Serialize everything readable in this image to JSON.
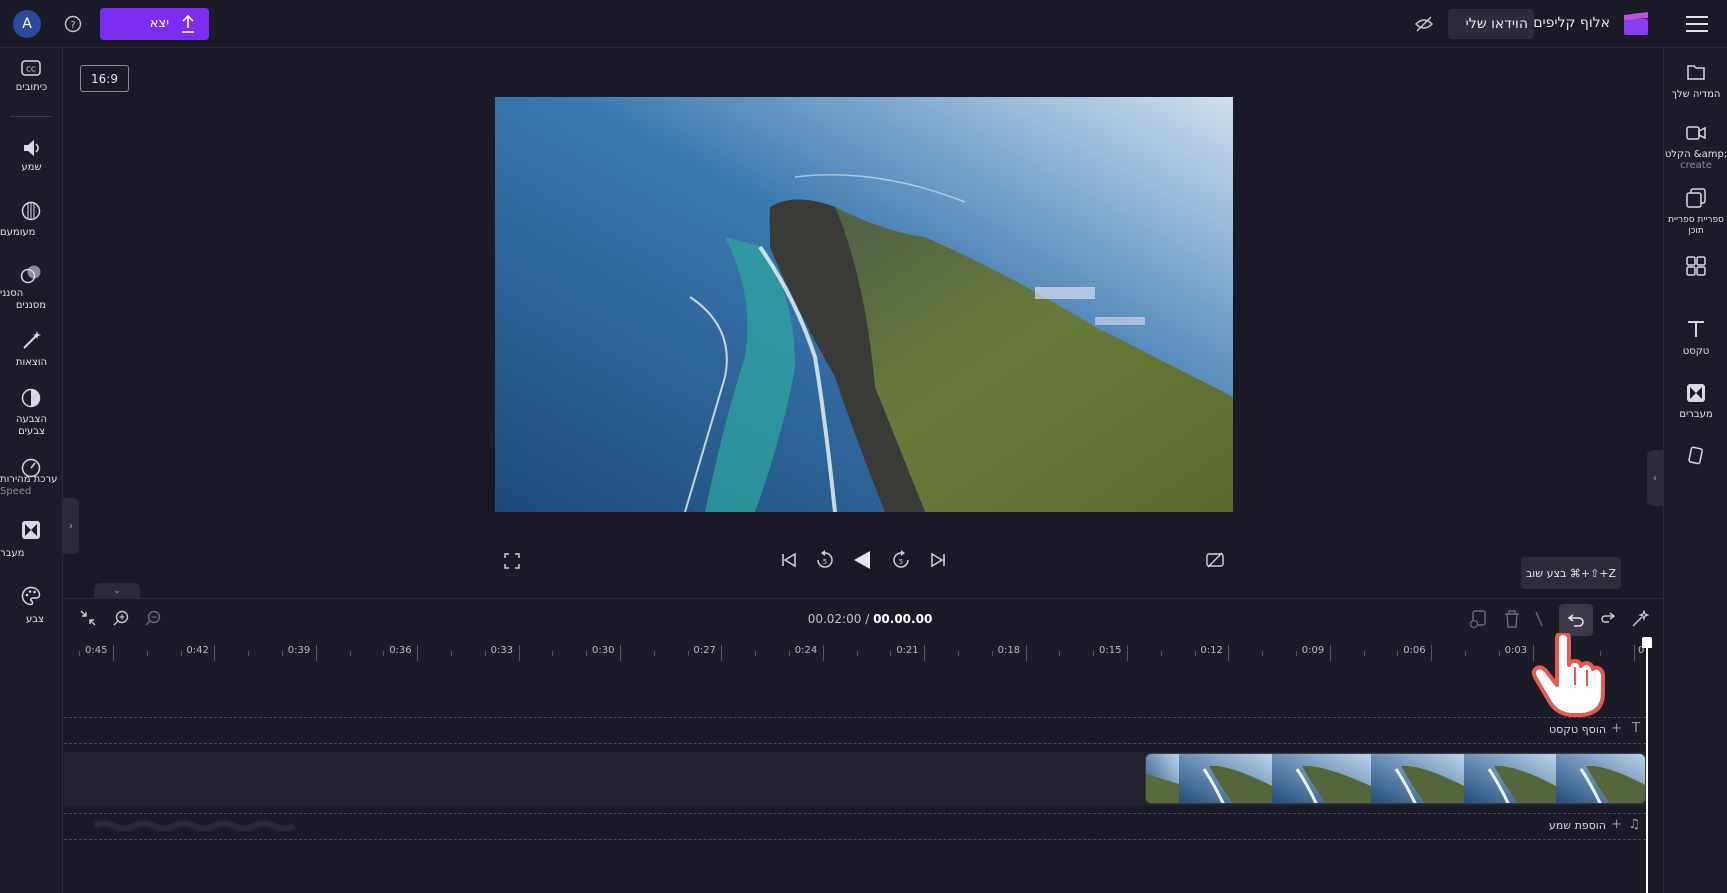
{
  "topbar": {
    "project_title": "הוידאו שלי",
    "app_name": "אלוף קליפים",
    "export_label": "יצא",
    "avatar_letter": "A",
    "menu_icon": "hamburger-icon",
    "hide_icon": "eye-off-icon",
    "help_icon": "help-icon",
    "export_icon": "upload-icon"
  },
  "preview": {
    "aspect_label": "16:9"
  },
  "left_tools": [
    {
      "label": "כיתובים",
      "icon": "captions-icon"
    },
    {
      "label": "שמע",
      "icon": "speaker-icon"
    },
    {
      "label": "מעומעם",
      "icon": "fade-icon"
    },
    {
      "label": "הסנני",
      "sub": "מסננים",
      "icon": "filters-icon"
    },
    {
      "label": "הוצאות",
      "icon": "effects-icon"
    },
    {
      "label": "הצבעה",
      "sub": "צבעים",
      "icon": "color-adjust-icon"
    },
    {
      "label": "ערכת מהירות",
      "sub": "Speed",
      "icon": "speed-icon"
    },
    {
      "label": "מעבר",
      "icon": "transitions-icon"
    },
    {
      "label": "צבע",
      "icon": "palette-icon"
    }
  ],
  "right_tools": [
    {
      "label": "המדיה שלך",
      "icon": "folder-icon"
    },
    {
      "label": "הקלט &amp;",
      "sub": "create",
      "icon": "record-icon"
    },
    {
      "label": "ספריית ספריית",
      "sub": "תוכן",
      "icon": "library-icon"
    },
    {
      "label": "",
      "icon": "templates-icon"
    },
    {
      "label": "טקסט",
      "icon": "text-icon"
    },
    {
      "label": "מעברים",
      "icon": "transitions-icon"
    },
    {
      "label": "",
      "icon": "brand-kit-icon"
    }
  ],
  "timeline": {
    "time_current": "00.00.00",
    "time_separator": "/",
    "time_total": "00.02:00",
    "undo_tooltip": "בצע שוב ⌘+⇧+Z",
    "add_text_label": "הוסף טקסט",
    "add_audio_label": "הוספת שמע",
    "ticks": [
      "0",
      "0:03",
      "0:06",
      "0:09",
      "0:12",
      "0:15",
      "0:18",
      "0:21",
      "0:24",
      "0:27",
      "0:30",
      "0:33",
      "0:36",
      "0:39",
      "0:42",
      "0:45"
    ]
  },
  "colors": {
    "accent": "#7a2df0",
    "background": "#1a1a26",
    "panel": "#1c1c29",
    "hand_outline": "#e85a50"
  }
}
